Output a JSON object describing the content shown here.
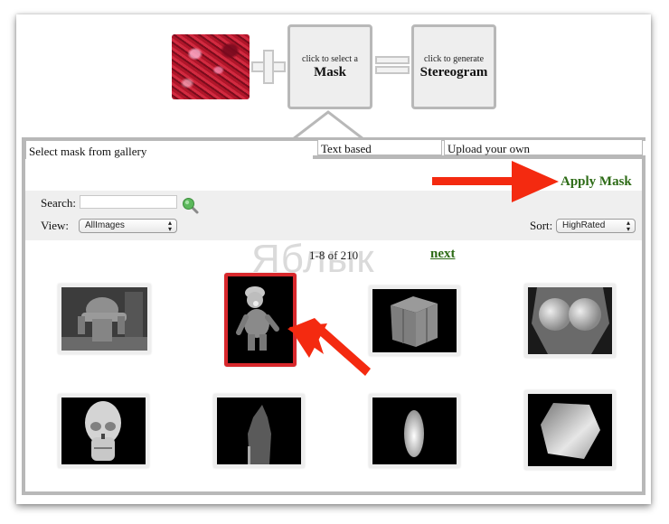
{
  "header": {
    "texture_alt": "red texture pattern",
    "plus_icon": "plus-icon",
    "equals_icon": "equals-icon",
    "mask_step": {
      "small": "click to select a",
      "big": "Mask"
    },
    "generate_step": {
      "small": "click to generate",
      "big": "Stereogram"
    }
  },
  "tabs": [
    {
      "label": "Select mask from gallery",
      "active": true
    },
    {
      "label": "Text based",
      "active": false
    },
    {
      "label": "Upload your own",
      "active": false
    }
  ],
  "panel": {
    "apply_label": "Apply Mask",
    "search_label": "Search:",
    "search_value": "",
    "view_label": "View:",
    "view_selected": "AllImages",
    "sort_label": "Sort:",
    "sort_selected": "HighRated",
    "pager_text": "1-8 of 210",
    "next_label": "next"
  },
  "watermark": "Яблык",
  "gallery": [
    {
      "name": "gorilla-depth-mask",
      "selected": false
    },
    {
      "name": "luigi-depth-mask",
      "selected": true
    },
    {
      "name": "crate-depth-mask",
      "selected": false
    },
    {
      "name": "torso-depth-mask",
      "selected": false
    },
    {
      "name": "skull-depth-mask",
      "selected": false
    },
    {
      "name": "warrior-depth-mask",
      "selected": false
    },
    {
      "name": "figure-depth-mask",
      "selected": false
    },
    {
      "name": "cube-depth-mask",
      "selected": false
    }
  ],
  "colors": {
    "accent_green": "#2d6b16",
    "annotation_red": "#f42a10",
    "selection_red": "#d8282c",
    "border_gray": "#b8b8b8"
  }
}
